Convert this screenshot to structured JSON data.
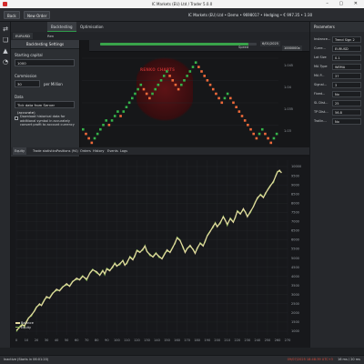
{
  "window": {
    "title": "IC Markets (EU) Ltd / Trader 5.0.0",
    "controls": "– ▢ ✕"
  },
  "toolbar": {
    "buttons": [
      "Back",
      "New Order"
    ],
    "info": "IC Markets (EU) Ltd • Demo • 9698017 • Hedging • € 997.35 • 1:30"
  },
  "tabs": [
    "Backtesting",
    "Optimisation"
  ],
  "symbol": {
    "name": "EURUSD",
    "timeframe": "Ren"
  },
  "playback": {
    "date": "6/01/2025",
    "speed_label": "Speed",
    "speed_value": "1000000x",
    "progress": 0.95
  },
  "watermark": "RENKO CHARTS",
  "settings": {
    "title": "Backtesting Settings",
    "capital_label": "Starting capital",
    "capital_value": "1000",
    "commission_label": "Commission",
    "commission_value": "30",
    "commission_unit": "per Million",
    "data_label": "Data",
    "data_value": "Tick data from Server (accurate)",
    "download_note": "Download historical data for additional symbol in accurately convert profit to account currency"
  },
  "price_axis": [
    "1.045",
    "1.04",
    "1.035",
    "1.03"
  ],
  "price_bricks": [
    1.0332,
    1.0324,
    1.0316,
    1.0308,
    1.0316,
    1.0324,
    1.0332,
    1.034,
    1.0348,
    1.034,
    1.0348,
    1.0356,
    1.0364,
    1.0356,
    1.0364,
    1.0372,
    1.038,
    1.0388,
    1.0396,
    1.0404,
    1.0412,
    1.0404,
    1.0396,
    1.0388,
    1.0396,
    1.0404,
    1.0412,
    1.042,
    1.0428,
    1.0436,
    1.0428,
    1.042,
    1.0412,
    1.0404,
    1.0412,
    1.042,
    1.0428,
    1.0436,
    1.0444,
    1.0452,
    1.0444,
    1.0436,
    1.0428,
    1.042,
    1.0412,
    1.0404,
    1.0396,
    1.0388,
    1.038,
    1.0388,
    1.0396,
    1.0388,
    1.038,
    1.0372,
    1.0364,
    1.0356,
    1.0348,
    1.034,
    1.0332,
    1.0324,
    1.0316,
    1.0324,
    1.0332,
    1.0324,
    1.0316,
    1.0308,
    1.0316,
    1.0324
  ],
  "parameters": {
    "header": "Parameters",
    "rows": [
      {
        "name": "Instance...",
        "value": "Trend Sign 2"
      },
      {
        "name": "Curre...",
        "value": "EURUSD"
      },
      {
        "name": "Lot Size",
        "value": "0.1"
      },
      {
        "name": "MA Type",
        "value": "WEMA"
      },
      {
        "name": "MA P...",
        "value": "37"
      },
      {
        "name": "Signal...",
        "value": "3"
      },
      {
        "name": "Fixed...",
        "value": "No"
      },
      {
        "name": "SL Dist...",
        "value": "25"
      },
      {
        "name": "TP Dist...",
        "value": "56.8"
      },
      {
        "name": "Trailin...",
        "value": "No"
      }
    ]
  },
  "equity_tabs": [
    "Equity",
    "Trade statistics",
    "Positions (94)",
    "Orders",
    "History",
    "Events",
    "Logs"
  ],
  "chart_data": {
    "type": "line",
    "series": [
      {
        "name": "Balance",
        "color": "#e3d9a0"
      },
      {
        "name": "Equity",
        "color": "#8fbc5a"
      }
    ],
    "x_ticks": [
      "0",
      "10",
      "20",
      "30",
      "40",
      "50",
      "60",
      "70",
      "80",
      "90",
      "100",
      "110",
      "120",
      "130",
      "140",
      "150",
      "160",
      "170",
      "180",
      "190",
      "200",
      "210",
      "220",
      "230",
      "240",
      "250",
      "260",
      "270"
    ],
    "y_ticks": [
      "10000",
      "9500",
      "9000",
      "8500",
      "8000",
      "7500",
      "7000",
      "6500",
      "6000",
      "5500",
      "5000",
      "4500",
      "4000",
      "3500",
      "3000",
      "2500",
      "2000",
      "1500",
      "1000"
    ],
    "points": [
      [
        0,
        1050
      ],
      [
        3,
        1200
      ],
      [
        6,
        1350
      ],
      [
        8,
        1300
      ],
      [
        10,
        1500
      ],
      [
        12,
        1700
      ],
      [
        15,
        1900
      ],
      [
        18,
        2100
      ],
      [
        20,
        2300
      ],
      [
        23,
        2500
      ],
      [
        25,
        2400
      ],
      [
        28,
        2700
      ],
      [
        30,
        2900
      ],
      [
        33,
        2800
      ],
      [
        36,
        3050
      ],
      [
        40,
        3300
      ],
      [
        43,
        3200
      ],
      [
        46,
        3400
      ],
      [
        50,
        3600
      ],
      [
        53,
        3450
      ],
      [
        56,
        3700
      ],
      [
        60,
        3900
      ],
      [
        63,
        3800
      ],
      [
        66,
        4000
      ],
      [
        70,
        3850
      ],
      [
        73,
        4150
      ],
      [
        76,
        4350
      ],
      [
        80,
        4250
      ],
      [
        83,
        4050
      ],
      [
        86,
        4300
      ],
      [
        88,
        4150
      ],
      [
        90,
        4400
      ],
      [
        93,
        4300
      ],
      [
        96,
        4550
      ],
      [
        98,
        4700
      ],
      [
        100,
        4550
      ],
      [
        103,
        4700
      ],
      [
        106,
        4850
      ],
      [
        108,
        4600
      ],
      [
        110,
        4750
      ],
      [
        113,
        5050
      ],
      [
        116,
        4900
      ],
      [
        118,
        5150
      ],
      [
        120,
        5400
      ],
      [
        123,
        5300
      ],
      [
        126,
        5500
      ],
      [
        128,
        5650
      ],
      [
        130,
        5350
      ],
      [
        133,
        5200
      ],
      [
        136,
        5050
      ],
      [
        139,
        5250
      ],
      [
        142,
        5100
      ],
      [
        145,
        4950
      ],
      [
        148,
        5250
      ],
      [
        150,
        5450
      ],
      [
        153,
        5300
      ],
      [
        156,
        5600
      ],
      [
        158,
        5850
      ],
      [
        160,
        6100
      ],
      [
        163,
        5950
      ],
      [
        166,
        5600
      ],
      [
        168,
        5300
      ],
      [
        170,
        5500
      ],
      [
        173,
        5700
      ],
      [
        176,
        5450
      ],
      [
        178,
        5250
      ],
      [
        180,
        5550
      ],
      [
        183,
        5800
      ],
      [
        186,
        5650
      ],
      [
        188,
        5950
      ],
      [
        190,
        6200
      ],
      [
        193,
        6450
      ],
      [
        196,
        6750
      ],
      [
        198,
        6900
      ],
      [
        200,
        6700
      ],
      [
        203,
        6950
      ],
      [
        206,
        7250
      ],
      [
        208,
        7050
      ],
      [
        210,
        6850
      ],
      [
        213,
        7150
      ],
      [
        216,
        6950
      ],
      [
        218,
        7250
      ],
      [
        220,
        7550
      ],
      [
        223,
        7400
      ],
      [
        226,
        7700
      ],
      [
        228,
        7500
      ],
      [
        230,
        7250
      ],
      [
        233,
        7550
      ],
      [
        236,
        7800
      ],
      [
        238,
        8050
      ],
      [
        240,
        8300
      ],
      [
        243,
        8450
      ],
      [
        246,
        8300
      ],
      [
        248,
        8550
      ],
      [
        250,
        8700
      ],
      [
        253,
        8950
      ],
      [
        256,
        9200
      ],
      [
        258,
        9450
      ],
      [
        260,
        9700
      ],
      [
        262,
        9800
      ],
      [
        264,
        9650
      ]
    ],
    "xlim": [
      0,
      270
    ],
    "ylim": [
      800,
      10350
    ],
    "grid": true,
    "legend": "bottom-left"
  },
  "status": {
    "left": "Inactive (Starts in 06:01:20)",
    "time": "09/07/2025 18:48:39 UTC+3",
    "ping": "16 ms / 20 ms"
  }
}
